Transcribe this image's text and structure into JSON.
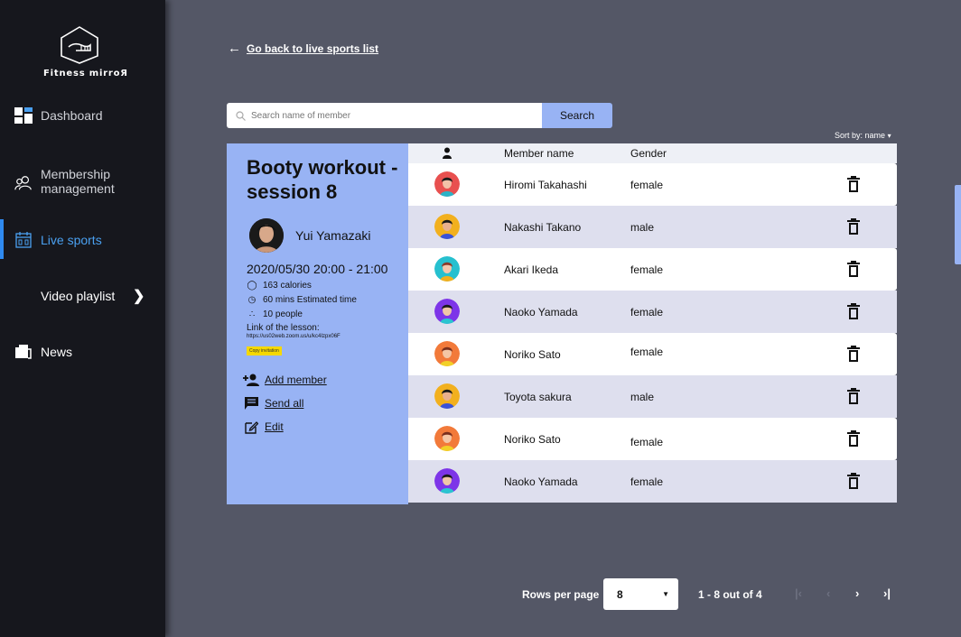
{
  "brand": {
    "name": "Fitness mirroЯ"
  },
  "sidebar": {
    "items": [
      {
        "label": "Dashboard",
        "icon": "dashboard-icon"
      },
      {
        "label": "Membership\nmanagement",
        "icon": "users-icon"
      },
      {
        "label": "Live sports",
        "icon": "calendar-icon",
        "active": true
      },
      {
        "label": "Video playlist",
        "icon": "chevron-right-icon"
      },
      {
        "label": "News",
        "icon": "news-icon"
      }
    ]
  },
  "back_link": {
    "label": "Go back to live sports list"
  },
  "search": {
    "placeholder": "Search name of member",
    "button_label": "Search"
  },
  "sort": {
    "label": "Sort by:",
    "value": "name"
  },
  "lesson": {
    "title": "Booty workout - session 8",
    "trainer": "Yui Yamazaki",
    "datetime": "2020/05/30 20:00 - 21:00",
    "calories": "163 calories",
    "duration": "60 mins Estimated time",
    "people": "10 people",
    "link_label": "Link of the lesson:",
    "link_url": "https://us02web.zoom.us/u/kc4Izpx06F",
    "copy_label": "Copy invitation",
    "actions": {
      "add": "Add member",
      "send": "Send all",
      "edit": "Edit"
    }
  },
  "table": {
    "headers": {
      "name": "Member name",
      "gender": "Gender"
    },
    "rows": [
      {
        "name": "Hiromi Takahashi",
        "gender": "female"
      },
      {
        "name": "Nakashi Takano",
        "gender": "male"
      },
      {
        "name": "Akari Ikeda",
        "gender": "female"
      },
      {
        "name": "Naoko Yamada",
        "gender": "female"
      },
      {
        "name": "Noriko Sato",
        "gender": "female"
      },
      {
        "name": "Toyota sakura",
        "gender": "male"
      },
      {
        "name": "Noriko Sato",
        "gender": "female"
      },
      {
        "name": "Naoko Yamada",
        "gender": "female"
      }
    ]
  },
  "pagination": {
    "rows_label": "Rows per page",
    "rows_value": "8",
    "range": "1 - 8 out of 4"
  },
  "colors": {
    "accent": "#98b3f4",
    "active_nav": "#4aa0f0",
    "background": "#545766",
    "sidebar": "#16171d"
  }
}
